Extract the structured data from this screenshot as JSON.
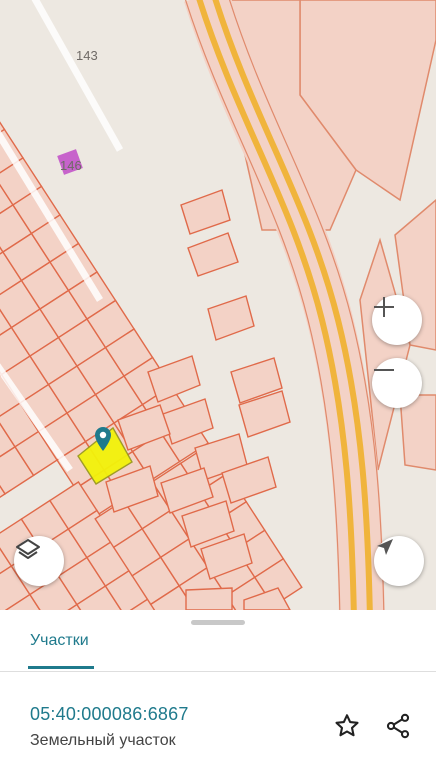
{
  "map": {
    "labels": {
      "house_143": "143",
      "house_146": "146"
    },
    "colors": {
      "background": "#ede8e1",
      "parcel_fill": "#f3d2c6",
      "parcel_stroke": "#e06a4a",
      "road": "#f0b43c",
      "selected_parcel": "#f2f20a",
      "marker": "#1f7a8c"
    },
    "controls": {
      "zoom_in_icon": "plus-icon",
      "zoom_out_icon": "minus-icon",
      "layers_icon": "layers-icon",
      "locate_icon": "navigation-arrow-icon"
    }
  },
  "sheet": {
    "tab_label": "Участки",
    "parcel": {
      "cadastral_number": "05:40:000086:6867",
      "type": "Земельный участок"
    },
    "actions": {
      "favorite_icon": "star-icon",
      "share_icon": "share-icon"
    }
  }
}
